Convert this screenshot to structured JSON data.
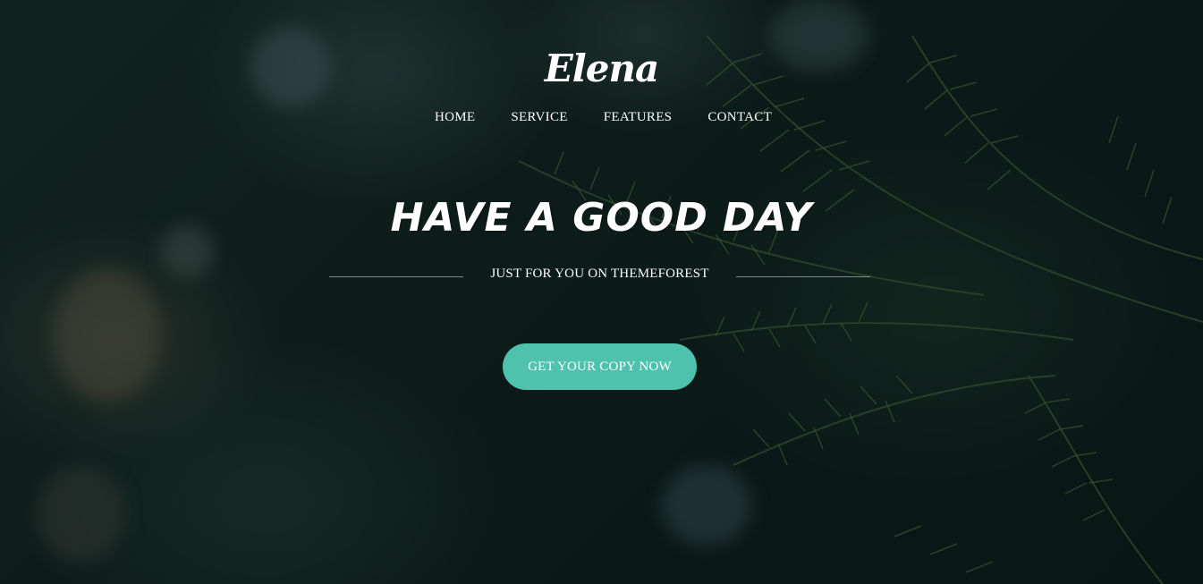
{
  "brand": {
    "logo_text": "Elena"
  },
  "nav": {
    "items": [
      {
        "label": "HOME"
      },
      {
        "label": "SERVICE"
      },
      {
        "label": "FEATURES"
      },
      {
        "label": "CONTACT"
      }
    ]
  },
  "hero": {
    "headline": "HAVE A GOOD DAY",
    "subheadline": "JUST FOR YOU ON THEMEFOREST",
    "cta_label": "GET YOUR COPY NOW"
  },
  "colors": {
    "accent": "#4fc2ad",
    "text": "#ffffff",
    "background": "#12211d"
  }
}
